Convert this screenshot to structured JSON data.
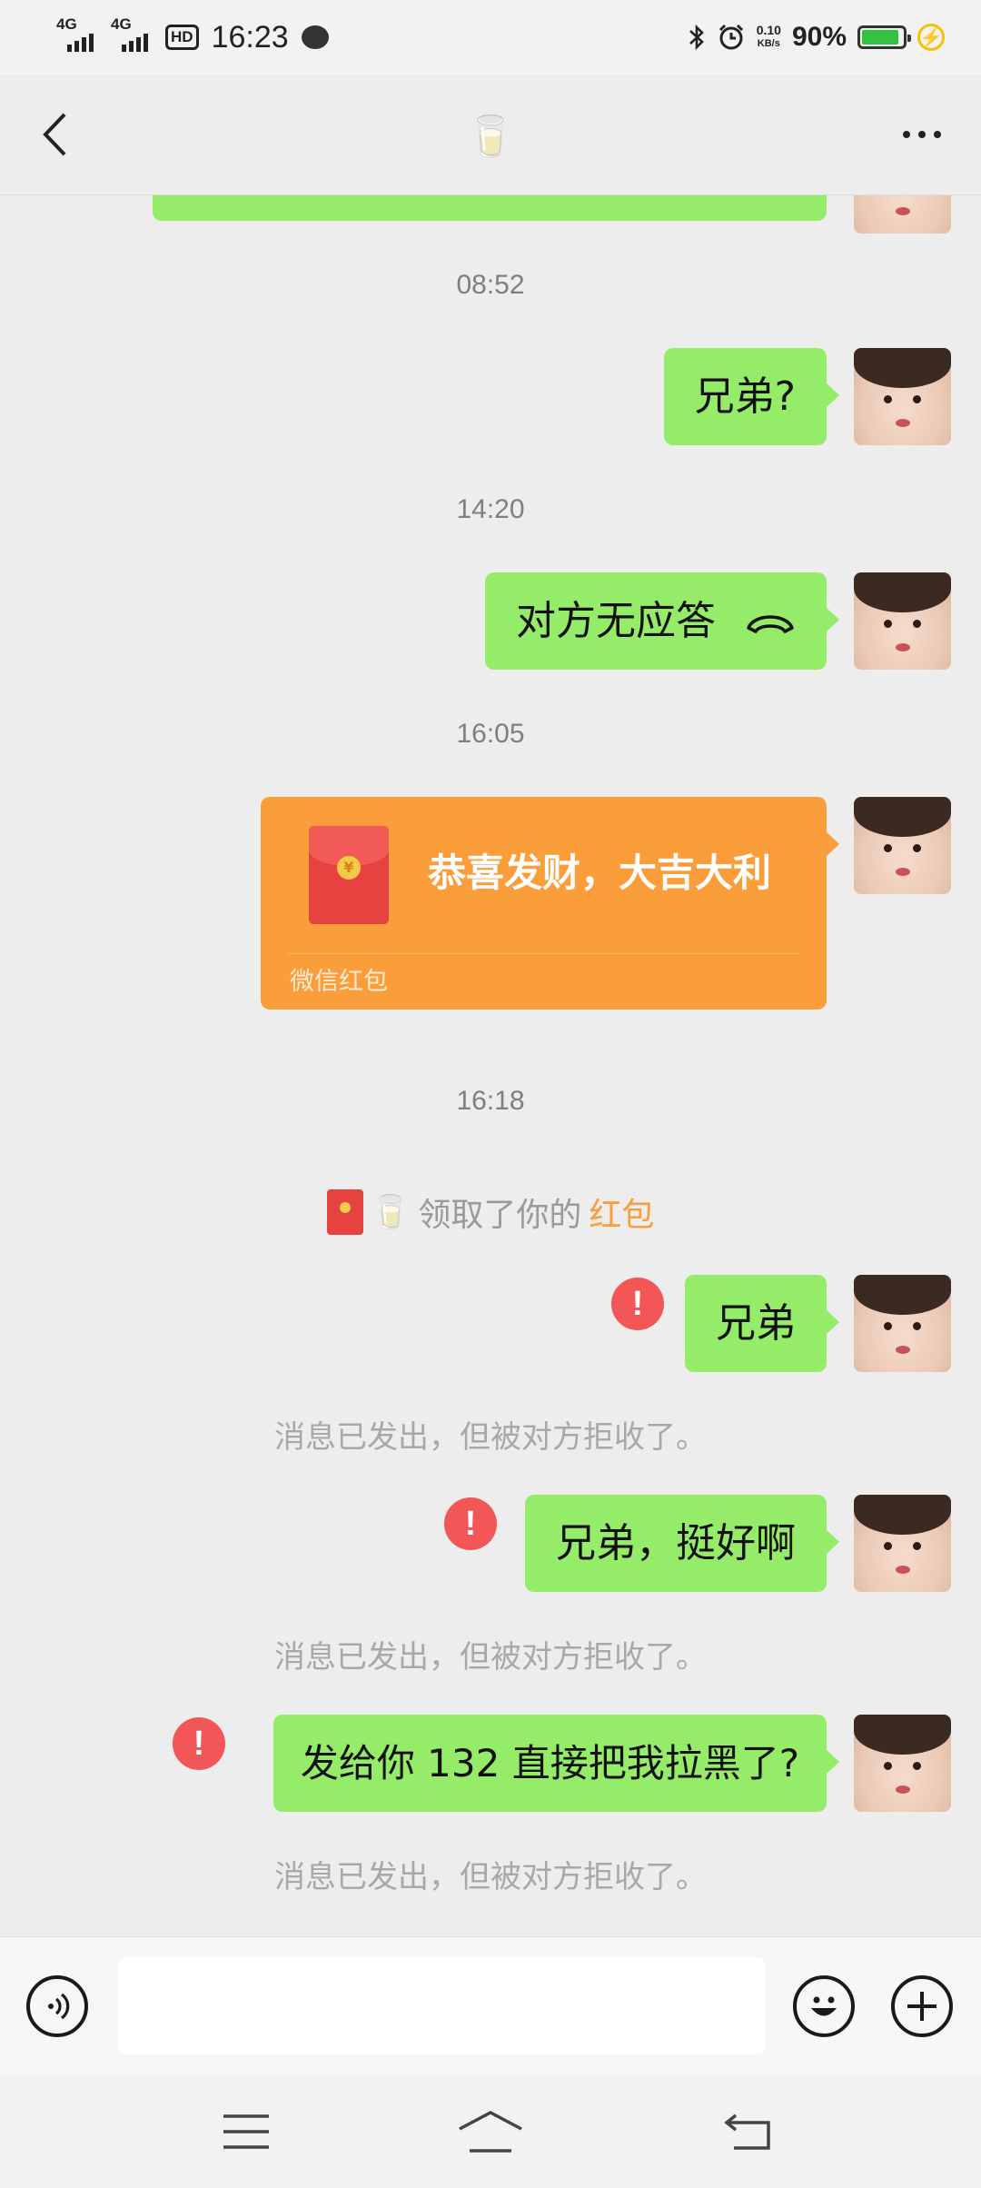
{
  "status_bar": {
    "signal_1": "4G",
    "signal_2": "4G",
    "hd_label": "HD",
    "time": "16:23",
    "net_speed_value": "0.10",
    "net_speed_unit": "KB/s",
    "battery_percent": "90%",
    "battery_level": 0.9
  },
  "header": {
    "title": "🥛"
  },
  "messages": {
    "time_1": "08:52",
    "msg_1": "兄弟?",
    "time_2": "14:20",
    "msg_2": "对方无应答",
    "time_3": "16:05",
    "red_packet": {
      "title": "恭喜发财，大吉大利",
      "footer": "微信红包",
      "coin_symbol": "¥"
    },
    "time_4": "16:18",
    "system_msg": {
      "name": "🥛",
      "text": "领取了你的",
      "link": "红包"
    },
    "msg_3": "兄弟",
    "notice_3": "消息已发出，但被对方拒收了。",
    "msg_4": "兄弟，挺好啊",
    "notice_4": "消息已发出，但被对方拒收了。",
    "msg_5": "发给你 132 直接把我拉黑了?",
    "notice_5": "消息已发出，但被对方拒收了。",
    "error_mark": "!"
  },
  "input_bar": {
    "value": ""
  },
  "icons": {
    "back": "chevron-left-icon",
    "more": "more-dots-icon",
    "voice": "voice-icon",
    "emoji": "emoji-icon",
    "plus": "plus-icon",
    "call": "phone-hangup-icon"
  },
  "colors": {
    "bubble": "#95ec69",
    "red_packet": "#fa9d3b",
    "error": "#f25656",
    "background": "#ededed"
  }
}
